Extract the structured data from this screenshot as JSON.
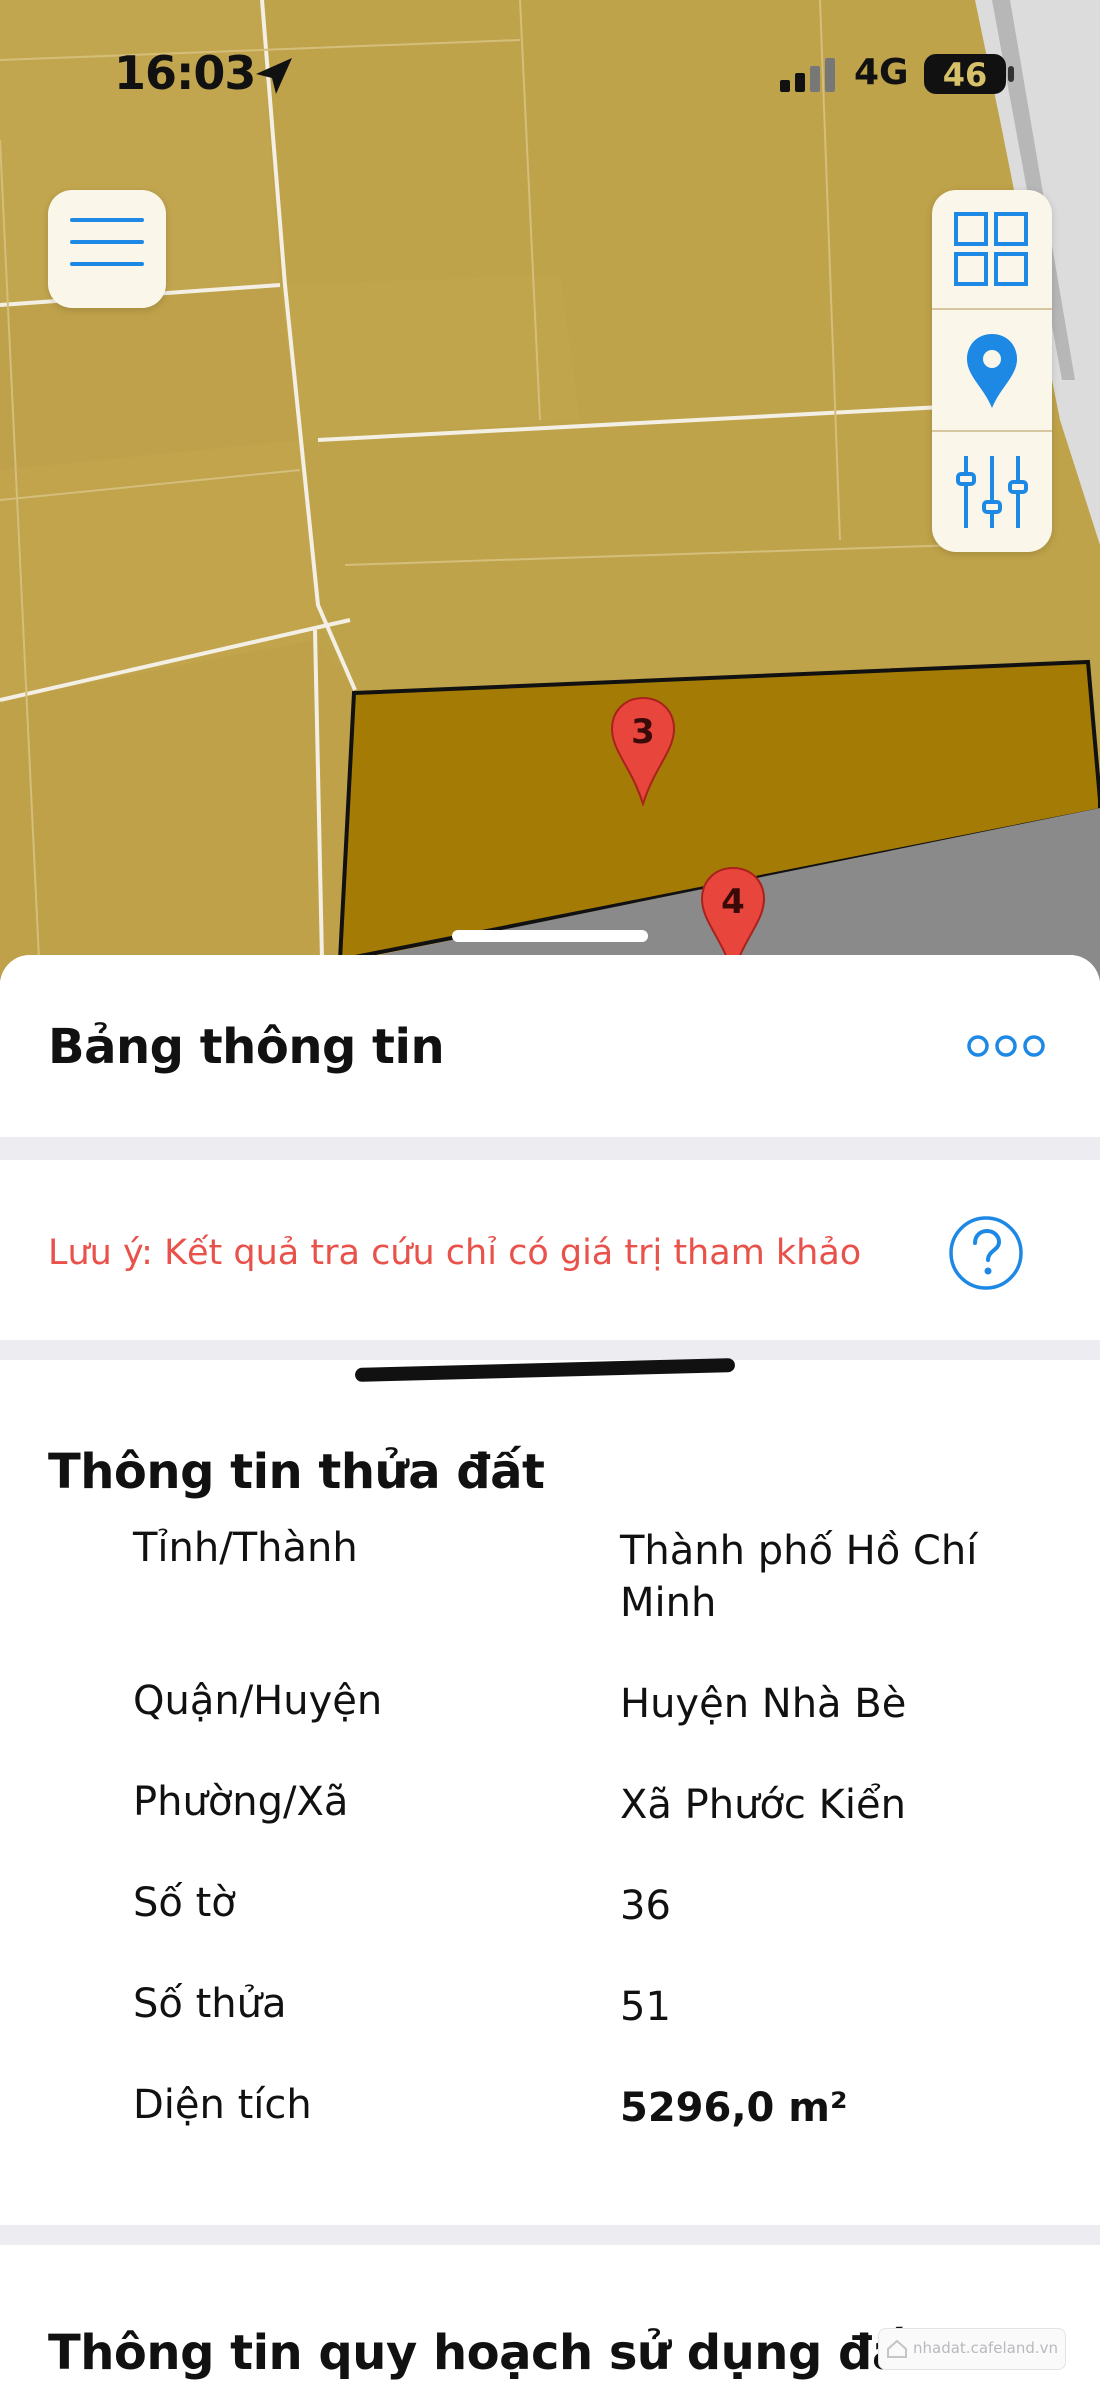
{
  "status_bar": {
    "time": "16:03",
    "network": "4G",
    "battery": "46"
  },
  "map": {
    "colors": {
      "parcel": "#bfa34a",
      "selected_parcel": "#a47b05",
      "road": "#8a8a8a",
      "line": "#f3efe4"
    },
    "markers": [
      {
        "label": "3"
      },
      {
        "label": "4"
      }
    ],
    "controls": [
      "menu-icon",
      "grid-icon",
      "location-pin-icon",
      "sliders-icon"
    ]
  },
  "panel": {
    "title": "Bảng thông tin",
    "note": "Lưu ý: Kết quả tra cứu chỉ có giá trị tham khảo",
    "parcel_info": {
      "title": "Thông tin thửa đất",
      "rows": [
        {
          "label": "Tỉnh/Thành",
          "value": "Thành phố Hồ Chí Minh"
        },
        {
          "label": "Quận/Huyện",
          "value": "Huyện Nhà Bè"
        },
        {
          "label": "Phường/Xã",
          "value": "Xã Phước Kiển"
        },
        {
          "label": "Số tờ",
          "value": "36"
        },
        {
          "label": "Số thửa",
          "value": "51"
        },
        {
          "label": "Diện tích",
          "value": "5296,0 m²"
        }
      ]
    },
    "planning_title": "Thông tin quy hoạch sử dụng đất"
  },
  "watermark": "nhadat.cafeland.vn"
}
